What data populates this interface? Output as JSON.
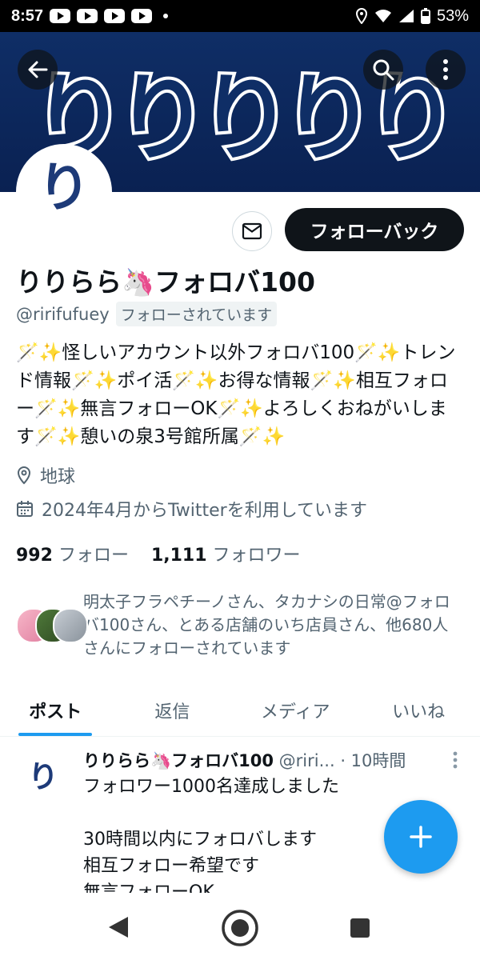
{
  "status_bar": {
    "time": "8:57",
    "battery": "53%"
  },
  "banner": {
    "art_text": "りりりりり"
  },
  "avatar": {
    "glyph": "り"
  },
  "profile": {
    "follow_back_label": "フォローバック",
    "name": "りりらら🦄フォロバ100",
    "handle": "@ririfufuey",
    "follows_you_label": "フォローされています",
    "bio": "🪄✨怪しいアカウント以外フォロバ100🪄✨トレンド情報🪄✨ポイ活🪄✨お得な情報🪄✨相互フォロー🪄✨無言フォローOK🪄✨よろしくおねがいします🪄✨憩いの泉3号館所属🪄✨",
    "location": "地球",
    "joined": "2024年4月からTwitterを利用しています",
    "following_count": "992",
    "following_label": "フォロー",
    "followers_count": "1,111",
    "followers_label": "フォロワー",
    "followed_by_text": "明太子フラペチーノさん、タカナシの日常@フォロバ100さん、とある店舗のいち店員さん、他680人さんにフォローされています"
  },
  "tabs": [
    {
      "label": "ポスト"
    },
    {
      "label": "返信"
    },
    {
      "label": "メディア"
    },
    {
      "label": "いいね"
    }
  ],
  "post": {
    "avatar_glyph": "り",
    "author": "りりらら🦄フォロバ100",
    "handle": "@riri...",
    "time": "· 10時間",
    "body": "フォロワー1000名達成しました\n\n30時間以内にフォロバします\n相互フォロー希望です\n無言フォローOK"
  },
  "colors": {
    "accent": "#1d9bf0",
    "banner": "#0f2e66",
    "text": "#0f1419",
    "secondary": "#536471"
  }
}
